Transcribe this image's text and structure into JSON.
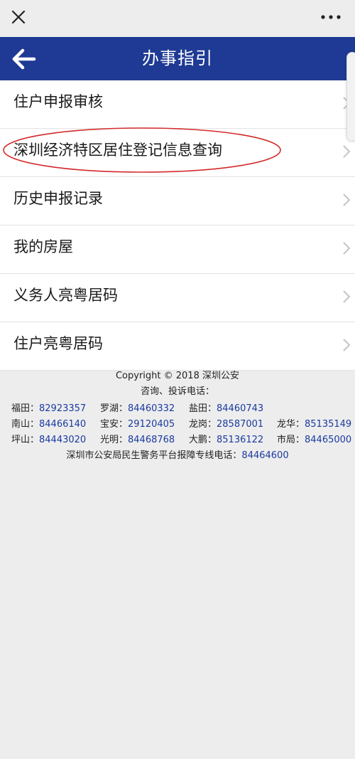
{
  "header": {
    "title": "办事指引"
  },
  "menu": {
    "items": [
      {
        "label": "住户申报审核"
      },
      {
        "label": "深圳经济特区居住登记信息查询"
      },
      {
        "label": "历史申报记录"
      },
      {
        "label": "我的房屋"
      },
      {
        "label": "义务人亮粤居码"
      },
      {
        "label": "住户亮粤居码"
      }
    ]
  },
  "footer": {
    "copyright": "Copyright © 2018 深圳公安",
    "consult_label": "咨询、投诉电话：",
    "rows": [
      [
        {
          "district": "福田：",
          "phone": "82923357"
        },
        {
          "district": "罗湖：",
          "phone": "84460332"
        },
        {
          "district": "盐田：",
          "phone": "84460743"
        }
      ],
      [
        {
          "district": "南山：",
          "phone": "84466140"
        },
        {
          "district": "宝安：",
          "phone": "29120405"
        },
        {
          "district": "龙岗：",
          "phone": "28587001"
        },
        {
          "district": "龙华：",
          "phone": "85135149"
        }
      ],
      [
        {
          "district": "坪山：",
          "phone": "84443020"
        },
        {
          "district": "光明：",
          "phone": "84468768"
        },
        {
          "district": "大鹏：",
          "phone": "85136122"
        },
        {
          "district": "市局：",
          "phone": "84465000"
        }
      ]
    ],
    "hotline_label": "深圳市公安局民生警务平台报障专线电话：",
    "hotline_phone": "84464600"
  },
  "colors": {
    "header_bg": "#1e3a94",
    "phone_text": "#1a3aa0",
    "highlight_ellipse": "#d42a2a"
  },
  "icons": {
    "close": "close-icon",
    "more": "more-dots-icon",
    "back": "arrow-left-icon",
    "chevron": "chevron-right-icon"
  }
}
